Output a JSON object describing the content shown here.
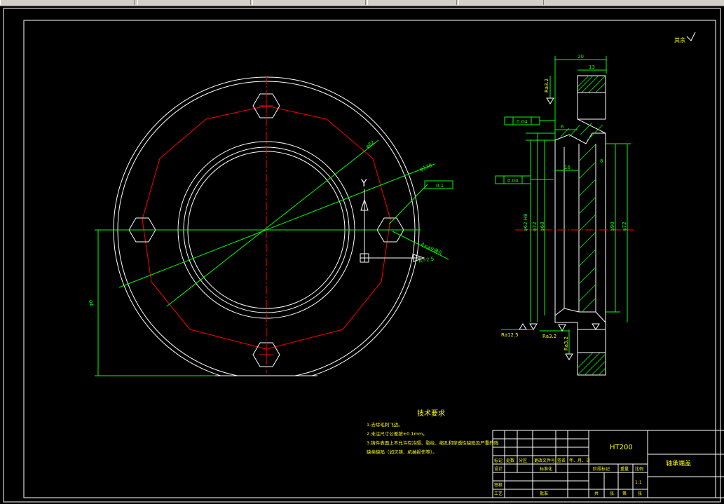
{
  "app": {
    "window_title": ""
  },
  "drawing": {
    "surface_roughness_note": "其余",
    "material": "HT200",
    "part_name": "轴承端盖",
    "tech_requirements": {
      "title": "技术要求",
      "items": [
        "1.去除毛刺飞边。",
        "2.未注尺寸公差按±0.1mm。",
        "3.铸件表面上不允许有冷隔、裂纹、缩孔和穿透性缺陷及严重的残",
        "  缺类缺陷（如欠铸、机械损伤等）。"
      ]
    },
    "dimensions": {
      "front_dia_small": "φ82",
      "front_dia_large": "φ120",
      "hole_note": "4×φ9通孔",
      "flatness_frame": "0.1",
      "r_note": "R=2.5",
      "left_height": "φ0",
      "top_width_1": "20",
      "top_width_2": "13",
      "ra_top": "Ra3.2",
      "ra_left": "Ra12.5",
      "ra_mid": "Ra3.2",
      "ra_bot": "Ra3.2",
      "perp_1": "0.04",
      "perp_2": "0.04",
      "mid_6": "6",
      "mid_16": "16",
      "mid_8": "8",
      "vert_d1": "φ62 H8",
      "vert_d2": "φ72",
      "vert_d3": "φ68",
      "vert_d4": "φ90",
      "vert_d5": "φ72"
    },
    "title_block": {
      "row_labels": [
        "标记",
        "处数",
        "分区",
        "更改文件号",
        "签名",
        "年、月、日"
      ],
      "design": "设计",
      "standard": "标准化",
      "stage_mark": "阶段标记",
      "weight": "重量",
      "scale": "比例",
      "scale_value": "1:1",
      "review": "审核",
      "process": "工艺",
      "approve": "批准",
      "sheets_total": "共",
      "sheet_n": "张",
      "sheet_of": "第",
      "sheet_n2": "张"
    },
    "ucs": {
      "y_label": "Y"
    }
  }
}
